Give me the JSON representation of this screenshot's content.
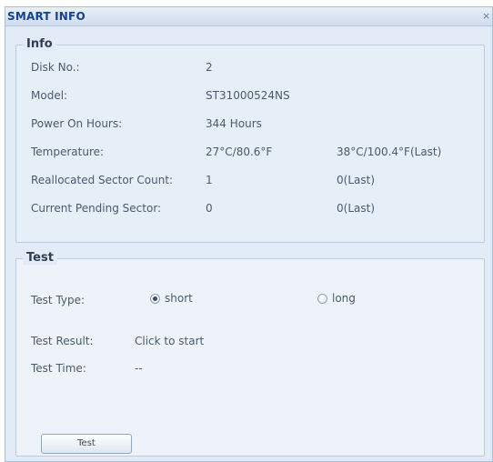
{
  "window": {
    "title": "SMART INFO",
    "close_label": "×"
  },
  "info": {
    "legend": "Info",
    "rows": [
      {
        "label": "Disk No.:",
        "value": "2",
        "extra": ""
      },
      {
        "label": "Model:",
        "value": "ST31000524NS",
        "extra": ""
      },
      {
        "label": "Power On Hours:",
        "value": "344 Hours",
        "extra": ""
      },
      {
        "label": "Temperature:",
        "value": "27°C/80.6°F",
        "extra": "38°C/100.4°F(Last)"
      },
      {
        "label": "Reallocated Sector Count:",
        "value": "1",
        "extra": "0(Last)"
      },
      {
        "label": "Current Pending Sector:",
        "value": "0",
        "extra": "0(Last)"
      }
    ]
  },
  "test": {
    "legend": "Test",
    "type_label": "Test Type:",
    "options": [
      {
        "label": "short",
        "checked": true
      },
      {
        "label": "long",
        "checked": false
      }
    ],
    "result_label": "Test Result:",
    "result_value": "Click to start",
    "time_label": "Test Time:",
    "time_value": "--",
    "button_label": "Test"
  }
}
